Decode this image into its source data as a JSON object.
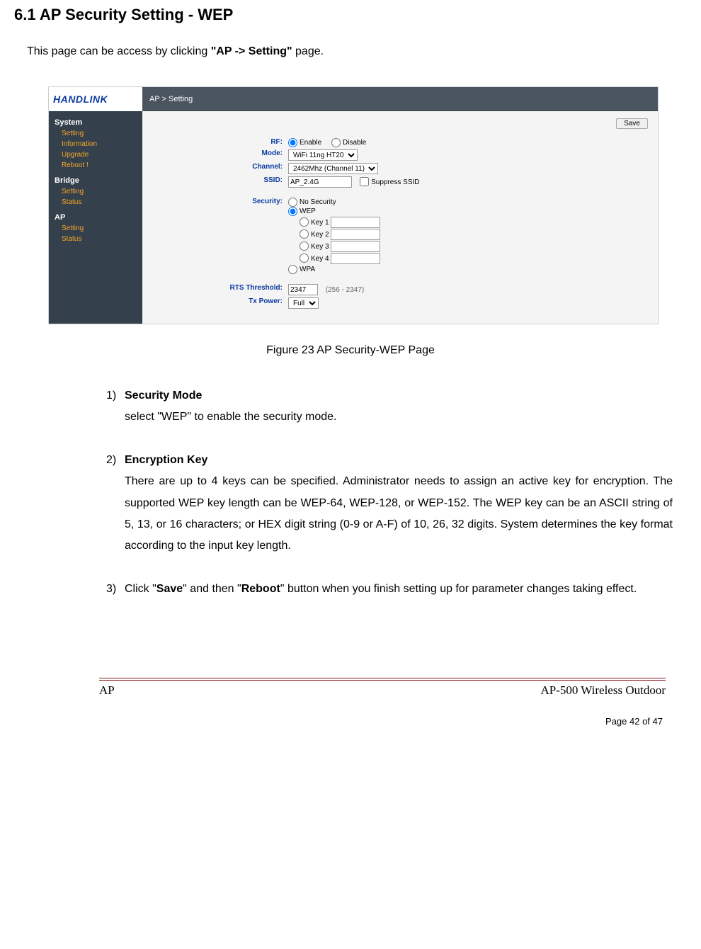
{
  "heading": "6.1    AP Security Setting - WEP",
  "intro_prefix": "This page can be access by clicking ",
  "intro_bold": "\"AP -> Setting\"",
  "intro_suffix": " page.",
  "figure_caption": "Figure 23    AP Security-WEP Page",
  "ss": {
    "logo": "HANDLINK",
    "breadcrumb": "AP > Setting",
    "save_label": "Save",
    "nav": {
      "system": {
        "title": "System",
        "items": [
          "Setting",
          "Information",
          "Upgrade",
          "Reboot !"
        ]
      },
      "bridge": {
        "title": "Bridge",
        "items": [
          "Setting",
          "Status"
        ]
      },
      "ap": {
        "title": "AP",
        "items": [
          "Setting",
          "Status"
        ]
      }
    },
    "form": {
      "rf_label": "RF:",
      "rf_enable": "Enable",
      "rf_disable": "Disable",
      "mode_label": "Mode:",
      "mode_value": "WiFi 11ng HT20",
      "channel_label": "Channel:",
      "channel_value": "2462Mhz (Channel 11)",
      "ssid_label": "SSID:",
      "ssid_value": "AP_2.4G",
      "suppress_label": "Suppress SSID",
      "security_label": "Security:",
      "no_security": "No Security",
      "wep": "WEP",
      "key1": "Key 1",
      "key2": "Key 2",
      "key3": "Key 3",
      "key4": "Key 4",
      "wpa": "WPA",
      "rts_label": "RTS Threshold:",
      "rts_value": "2347",
      "rts_range": "(256 - 2347)",
      "txpower_label": "Tx Power:",
      "txpower_value": "Full"
    }
  },
  "items": {
    "i1_num": "1)",
    "i1_head": "Security Mode",
    "i1_body": "select \"WEP\" to enable the security mode.",
    "i2_num": "2)",
    "i2_head": "Encryption Key",
    "i2_body": "There are up to 4 keys can be specified. Administrator needs to assign an active key for encryption.    The supported WEP key length can be WEP-64, WEP-128, or WEP-152.    The WEP key can be an ASCII string of 5, 13, or 16 characters; or HEX digit string (0-9 or A-F) of 10, 26, 32 digits. System determines the key format according to the input key length.",
    "i3_num": "3)",
    "i3_pre": "Click \"",
    "i3_save": "Save",
    "i3_mid": "\" and then \"",
    "i3_reboot": "Reboot",
    "i3_post": "\" button when you finish setting up for parameter changes taking effect."
  },
  "footer": {
    "left": "AP",
    "right": "AP-500    Wireless  Outdoor",
    "page": "Page 42 of 47"
  }
}
